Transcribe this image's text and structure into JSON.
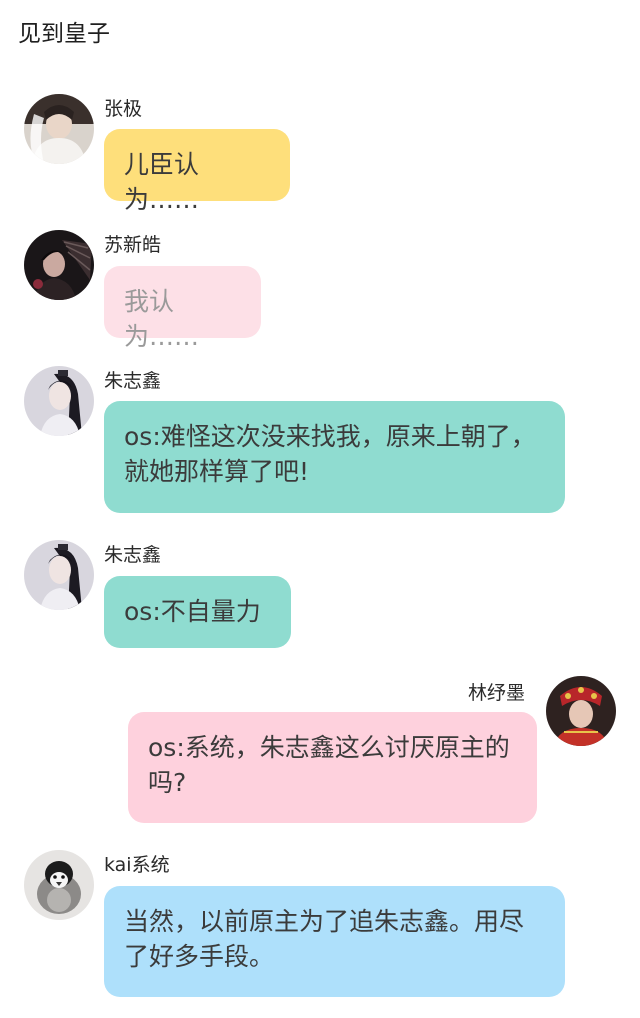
{
  "header": {
    "title": "见到皇子"
  },
  "messages": [
    {
      "name": "张极",
      "text": "儿臣认为……",
      "bubble_color": "#fedf7b",
      "avatar": "avatar-white-veil"
    },
    {
      "name": "苏新皓",
      "text": "我认为……",
      "bubble_color": "#fde0e7",
      "avatar": "avatar-dark-fan"
    },
    {
      "name": "朱志鑫",
      "text": "os:难怪这次没来找我，原来上朝了，就她那样算了吧!",
      "bubble_color": "#8fdcd0",
      "avatar": "avatar-long-hair"
    },
    {
      "name": "朱志鑫",
      "text": "os:不自量力",
      "bubble_color": "#8fdcd0",
      "avatar": "avatar-long-hair"
    },
    {
      "name": "林纾墨",
      "text": "os:系统，朱志鑫这么讨厌原主的吗?",
      "bubble_color": "#fed1dd",
      "avatar": "avatar-red-headdress"
    },
    {
      "name": "kai系统",
      "text": "当然，以前原主为了追朱志鑫。用尽了好多手段。",
      "bubble_color": "#aee0fb",
      "avatar": "avatar-penguin"
    }
  ]
}
